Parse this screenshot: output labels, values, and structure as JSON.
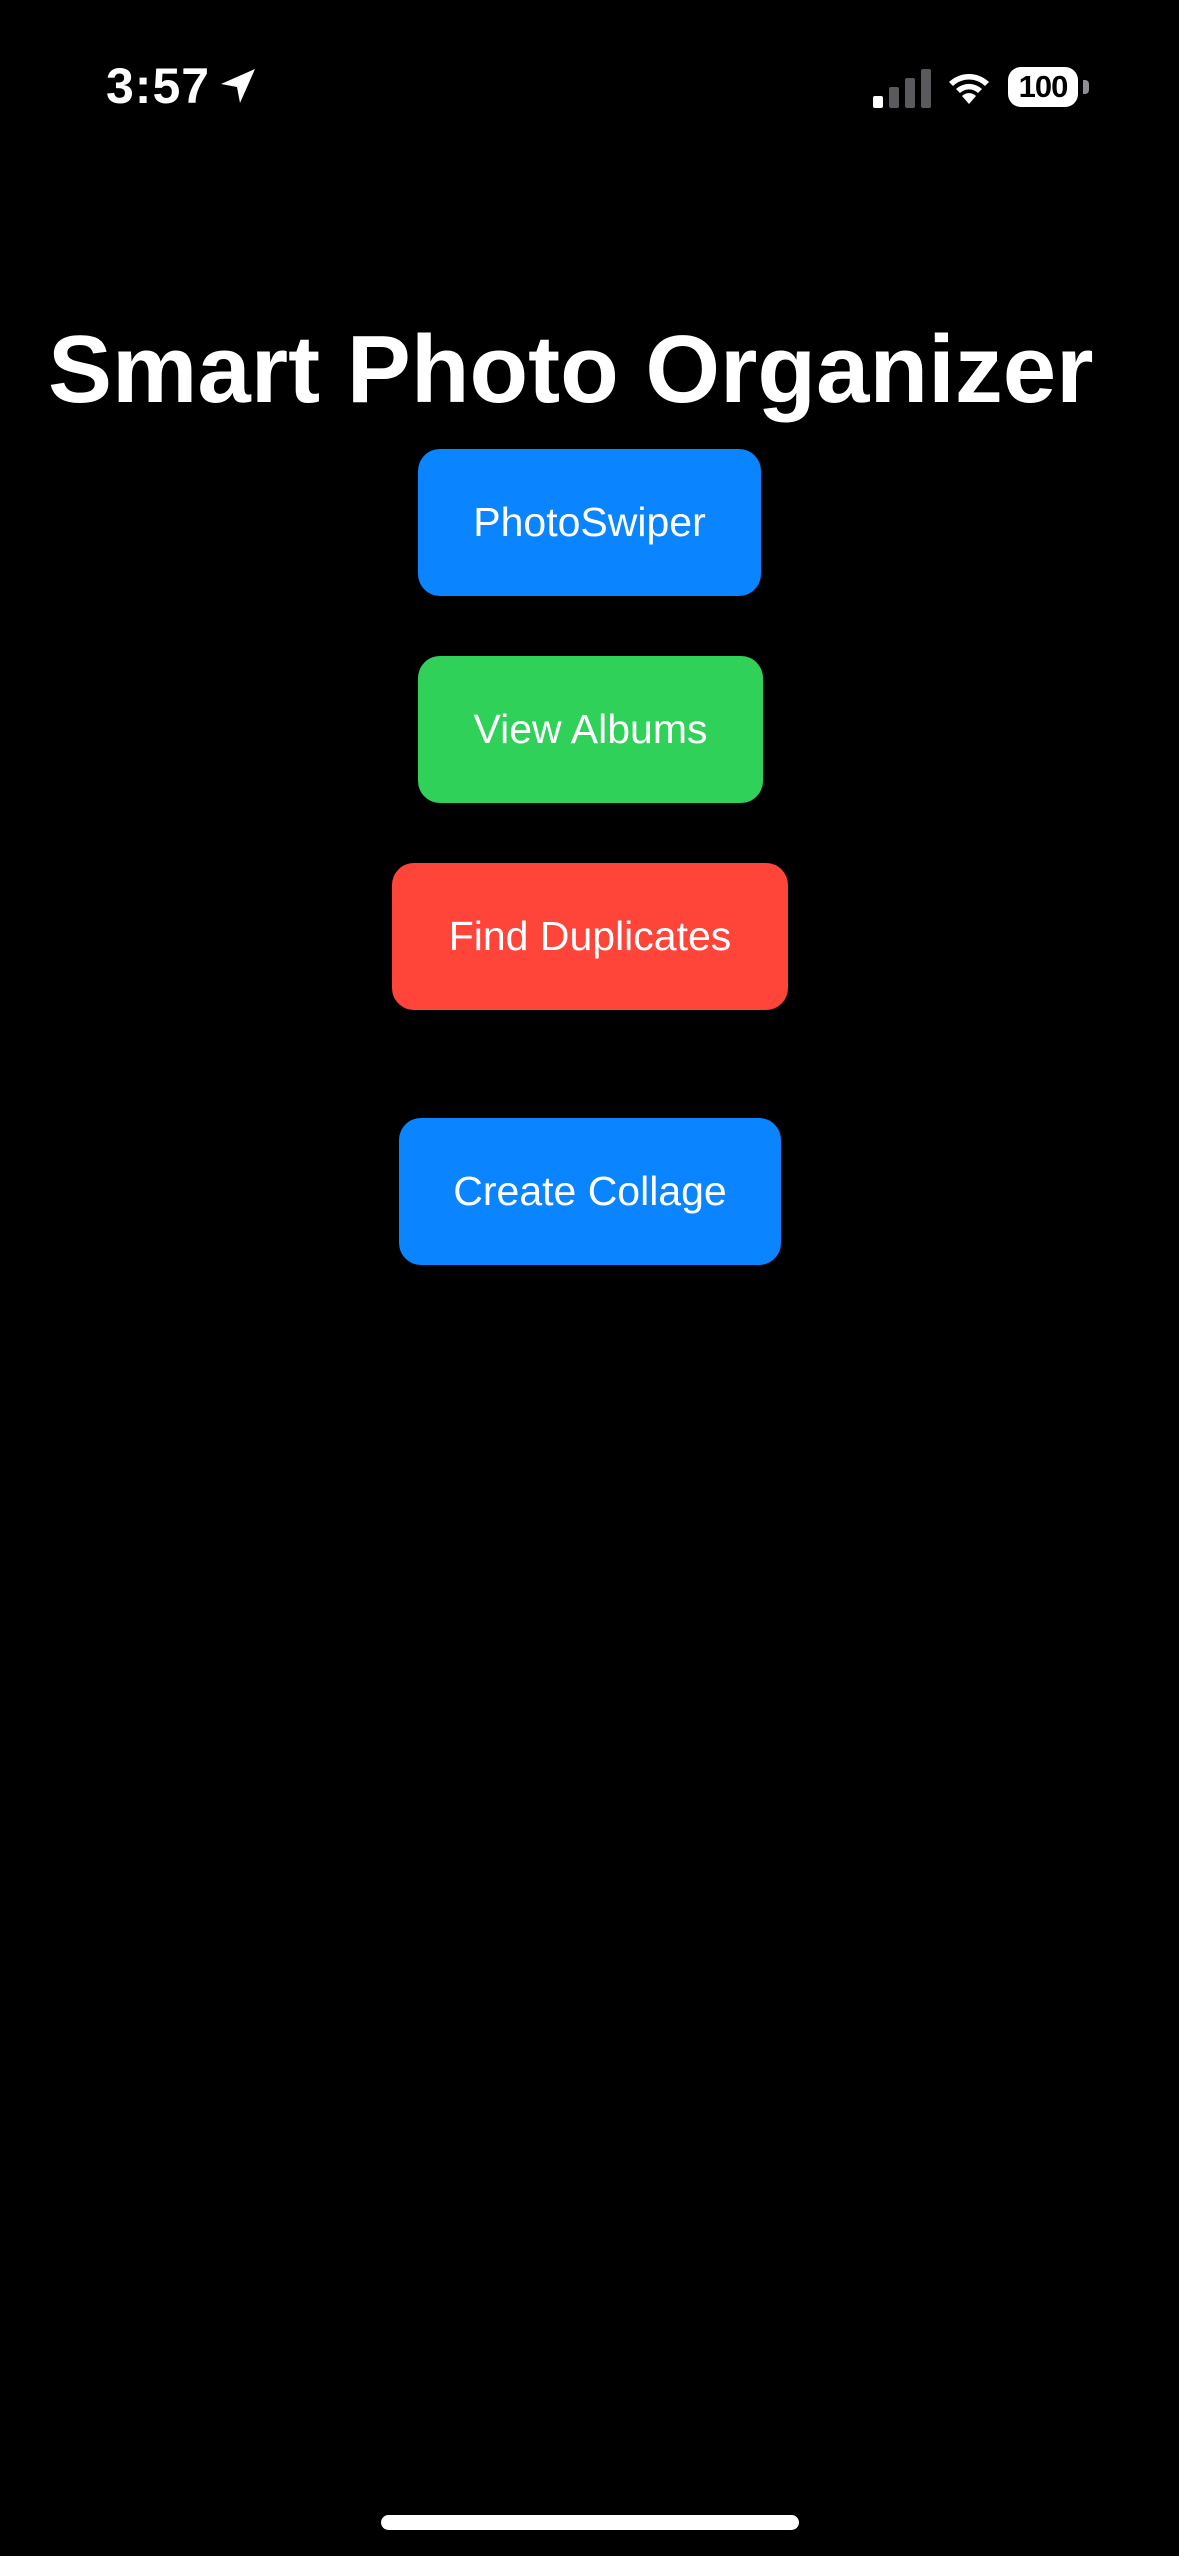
{
  "status_bar": {
    "time": "3:57",
    "battery_level": "100",
    "icons": [
      "location-arrow-icon",
      "cellular-signal-icon",
      "wifi-icon",
      "battery-icon"
    ]
  },
  "main": {
    "title": "Smart Photo Organizer",
    "buttons": [
      {
        "label": "PhotoSwiper",
        "color": "#0a84ff"
      },
      {
        "label": "View Albums",
        "color": "#30d158"
      },
      {
        "label": "Find Duplicates",
        "color": "#ff453a"
      },
      {
        "label": "Create Collage",
        "color": "#0a84ff"
      }
    ]
  },
  "theme": {
    "background": "#000000",
    "text": "#ffffff"
  }
}
